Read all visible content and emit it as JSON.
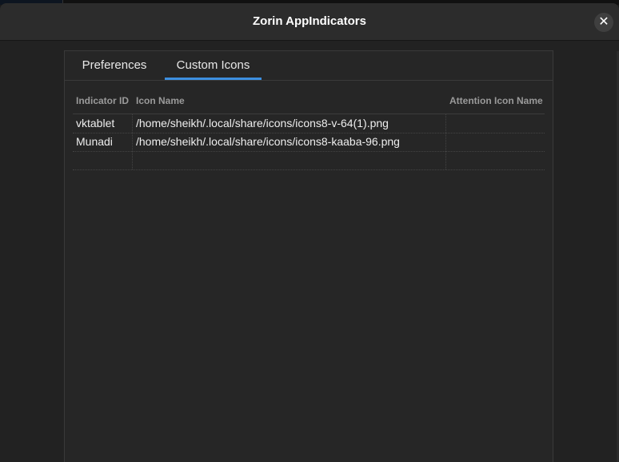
{
  "window": {
    "title": "Zorin AppIndicators"
  },
  "tabs": [
    {
      "label": "Preferences",
      "active": false
    },
    {
      "label": "Custom Icons",
      "active": true
    }
  ],
  "table": {
    "columns": [
      "Indicator ID",
      "Icon Name",
      "Attention Icon Name"
    ],
    "rows": [
      [
        "vktablet",
        "/home/sheikh/.local/share/icons/icons8-v-64(1).png",
        ""
      ],
      [
        "Munadi",
        "/home/sheikh/.local/share/icons/icons8-kaaba-96.png",
        ""
      ],
      [
        "",
        "",
        ""
      ]
    ]
  },
  "colors": {
    "accent": "#3d8fe0",
    "window_bg": "#222222",
    "titlebar_bg": "#2c2c2c"
  },
  "icons": {
    "close": "close-icon"
  }
}
